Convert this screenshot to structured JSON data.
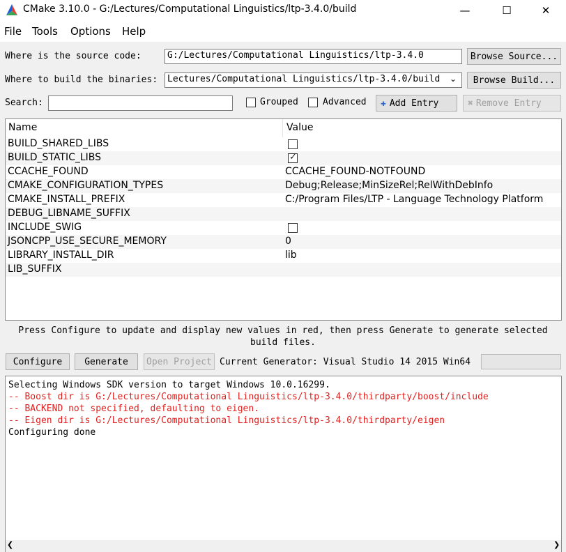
{
  "window": {
    "title": "CMake 3.10.0 - G:/Lectures/Computational Linguistics/ltp-3.4.0/build",
    "minimize": "—",
    "maximize": "☐",
    "close": "✕"
  },
  "menu": {
    "file": "File",
    "tools": "Tools",
    "options": "Options",
    "help": "Help"
  },
  "source": {
    "label": "Where is the source code:",
    "value": "G:/Lectures/Computational Linguistics/ltp-3.4.0",
    "browse": "Browse Source..."
  },
  "build": {
    "label": "Where to build the binaries:",
    "value": "Lectures/Computational Linguistics/ltp-3.4.0/build",
    "browse": "Browse Build..."
  },
  "search": {
    "label": "Search:",
    "value": "",
    "grouped_label": "Grouped",
    "advanced_label": "Advanced",
    "add_entry": "Add Entry",
    "remove_entry": "Remove Entry"
  },
  "table": {
    "headers": {
      "name": "Name",
      "value": "Value"
    },
    "rows": [
      {
        "name": "BUILD_SHARED_LIBS",
        "value": "",
        "checkbox": true,
        "checked": false
      },
      {
        "name": "BUILD_STATIC_LIBS",
        "value": "",
        "checkbox": true,
        "checked": true
      },
      {
        "name": "CCACHE_FOUND",
        "value": "CCACHE_FOUND-NOTFOUND"
      },
      {
        "name": "CMAKE_CONFIGURATION_TYPES",
        "value": "Debug;Release;MinSizeRel;RelWithDebInfo"
      },
      {
        "name": "CMAKE_INSTALL_PREFIX",
        "value": "C:/Program Files/LTP - Language Technology Platform"
      },
      {
        "name": "DEBUG_LIBNAME_SUFFIX",
        "value": ""
      },
      {
        "name": "INCLUDE_SWIG",
        "value": "",
        "checkbox": true,
        "checked": false
      },
      {
        "name": "JSONCPP_USE_SECURE_MEMORY",
        "value": "0"
      },
      {
        "name": "LIBRARY_INSTALL_DIR",
        "value": "lib"
      },
      {
        "name": "LIB_SUFFIX",
        "value": ""
      }
    ]
  },
  "hint": {
    "line1": "Press Configure to update and display new values in red, then press Generate to generate selected",
    "line2": "build files."
  },
  "actions": {
    "configure": "Configure",
    "generate": "Generate",
    "open_project": "Open Project",
    "generator": "Current Generator: Visual Studio 14 2015 Win64"
  },
  "output": [
    {
      "text": "Selecting Windows SDK version  to target Windows 10.0.16299.",
      "color": "#000000"
    },
    {
      "text": "-- Boost dir is G:/Lectures/Computational Linguistics/ltp-3.4.0/thirdparty/boost/include",
      "color": "#e02020"
    },
    {
      "text": "-- BACKEND not specified, defaulting to eigen.",
      "color": "#e02020"
    },
    {
      "text": "-- Eigen dir is G:/Lectures/Computational Linguistics/ltp-3.4.0/thirdparty/eigen",
      "color": "#e02020"
    },
    {
      "text": "Configuring done",
      "color": "#000000"
    }
  ],
  "scroll": {
    "left": "❮",
    "right": "❯"
  }
}
